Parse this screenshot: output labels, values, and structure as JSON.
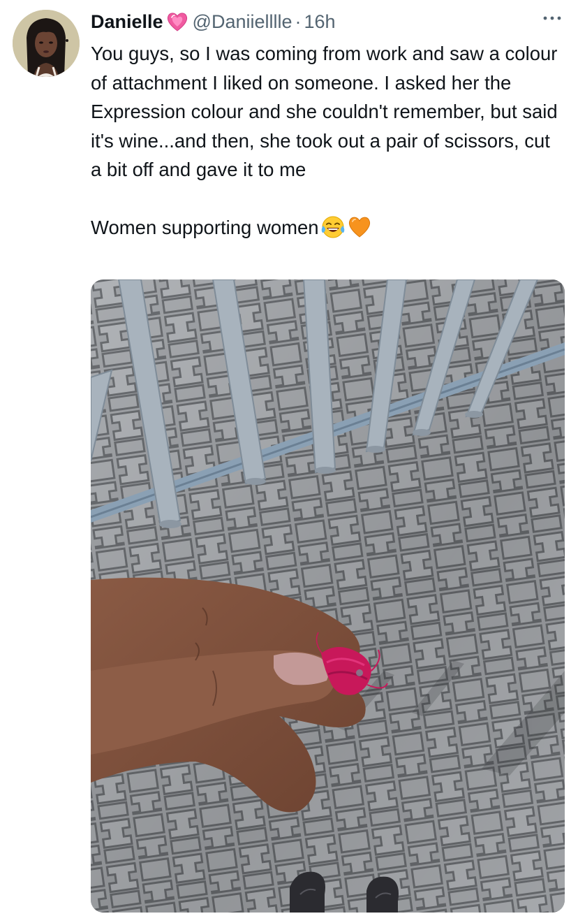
{
  "tweet": {
    "author": {
      "display_name": "Danielle",
      "name_emoji": "pink-heart",
      "handle": "@Daniielllle",
      "separator": "·",
      "timestamp": "16h"
    },
    "text": {
      "paragraph_1": "You guys, so I was coming from work and saw a colour of attachment I liked on someone. I asked her the Expression colour and she couldn't remember, but said it's wine...and then, she took out a pair of scissors, cut a bit off and gave it to me",
      "paragraph_2": "Women supporting women",
      "paragraph_2_emojis": [
        "tears-of-joy",
        "orange-heart"
      ]
    },
    "media": {
      "type": "photo"
    },
    "colors": {
      "text": "#0f1419",
      "secondary": "#536471",
      "heart_pink": "#f05aa0",
      "heart_orange": "#f7931e",
      "hair_wine": "#c8185a"
    }
  }
}
